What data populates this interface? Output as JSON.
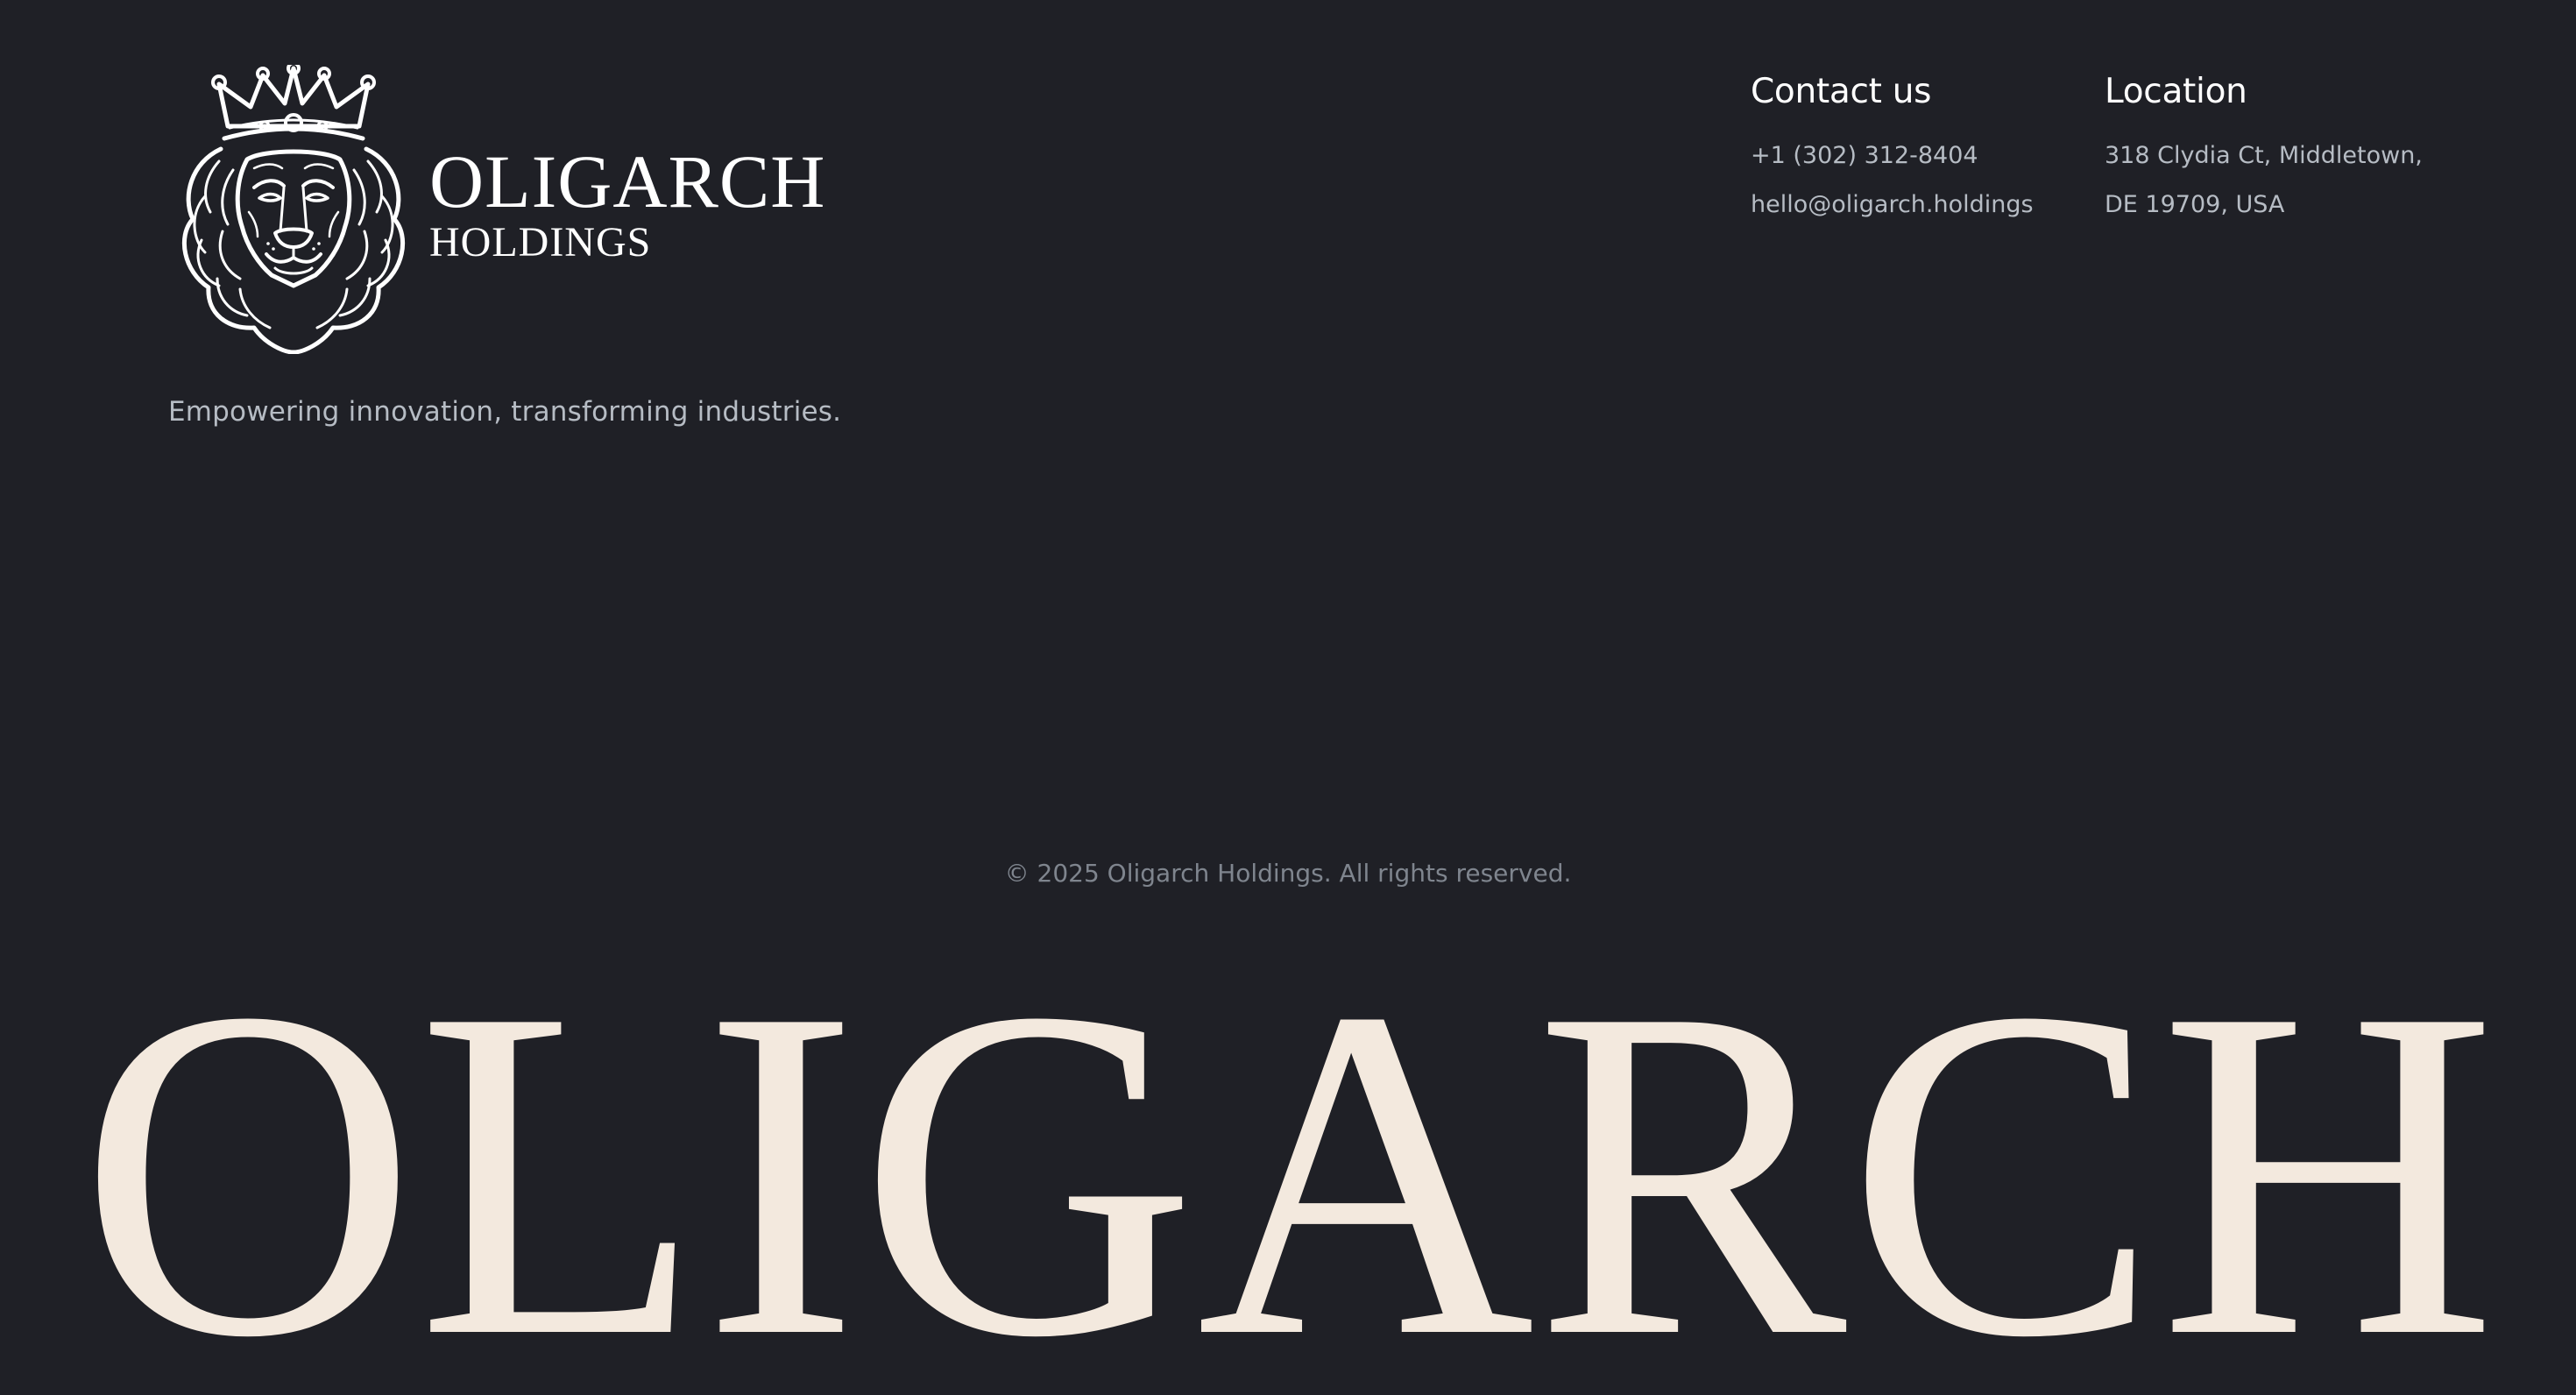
{
  "brand": {
    "wordmark_main": "OLIGARCH",
    "wordmark_sub": "HOLDINGS",
    "logo_icon": "crowned-lion-icon",
    "tagline": "Empowering innovation, transforming industries."
  },
  "contact": {
    "heading": "Contact us",
    "phone": "+1 (302) 312-8404",
    "email": "hello@oligarch.holdings"
  },
  "location": {
    "heading": "Location",
    "address_line1": "318 Clydia Ct, Middletown,",
    "address_line2": "DE 19709, USA"
  },
  "footer": {
    "copyright": "© 2025 Oligarch Holdings. All rights reserved.",
    "giant_wordmark": "OLIGARCH"
  },
  "colors": {
    "background": "#1f2026",
    "heading": "#ffffff",
    "body_text": "#b6bcc4",
    "muted_text": "#7f858e",
    "giant_wordmark": "#f3e9de"
  }
}
